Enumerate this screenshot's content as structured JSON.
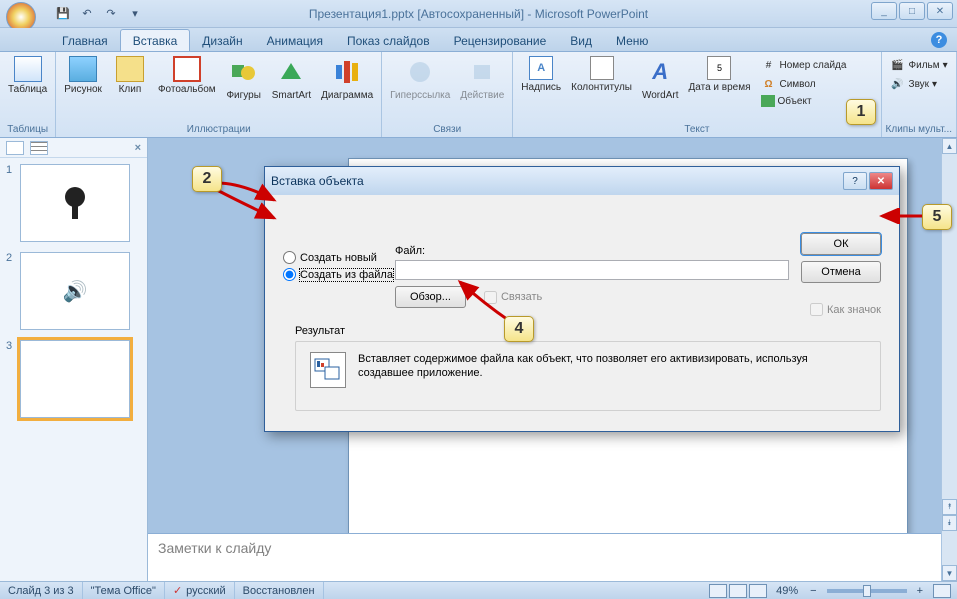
{
  "title": "Презентация1.pptx [Автосохраненный] - Microsoft PowerPoint",
  "qat": {
    "save": "💾",
    "undo": "↶",
    "redo": "↷",
    "more": "▾"
  },
  "win": {
    "min": "_",
    "max": "□",
    "close": "✕"
  },
  "tabs": {
    "home": "Главная",
    "insert": "Вставка",
    "design": "Дизайн",
    "anim": "Анимация",
    "show": "Показ слайдов",
    "review": "Рецензирование",
    "view": "Вид",
    "menu": "Меню"
  },
  "ribbon": {
    "tables": {
      "table": "Таблица",
      "group": "Таблицы"
    },
    "illu": {
      "picture": "Рисунок",
      "clip": "Клип",
      "album": "Фотоальбом",
      "shapes": "Фигуры",
      "smartart": "SmartArt",
      "chart": "Диаграмма",
      "group": "Иллюстрации"
    },
    "links": {
      "hyperlink": "Гиперссылка",
      "action": "Действие",
      "group": "Связи"
    },
    "text": {
      "textbox": "Надпись",
      "headf": "Колонтитулы",
      "wordart": "WordArt",
      "date": "Дата и время",
      "slidenum": "Номер слайда",
      "symbol": "Символ",
      "object": "Объект",
      "group": "Текст"
    },
    "media": {
      "movie": "Фильм",
      "sound": "Звук",
      "group": "Клипы мульт..."
    }
  },
  "thumbs": {
    "n1": "1",
    "n2": "2",
    "n3": "3"
  },
  "notes": "Заметки к слайду",
  "status": {
    "slide": "Слайд 3 из 3",
    "theme": "\"Тема Office\"",
    "lang": "русский",
    "recovered": "Восстановлен",
    "zoom": "49%"
  },
  "dialog": {
    "title": "Вставка объекта",
    "create_new": "Создать новый",
    "from_file": "Создать из файла",
    "file_label": "Файл:",
    "file_value": "",
    "browse": "Обзор...",
    "link": "Связать",
    "ok": "ОК",
    "cancel": "Отмена",
    "as_icon": "Как значок",
    "result_label": "Результат",
    "result_text": "Вставляет содержимое файла как объект, что позволяет его активизировать, используя создавшее приложение."
  },
  "callouts": {
    "c1": "1",
    "c2": "2",
    "c4": "4",
    "c5": "5"
  }
}
